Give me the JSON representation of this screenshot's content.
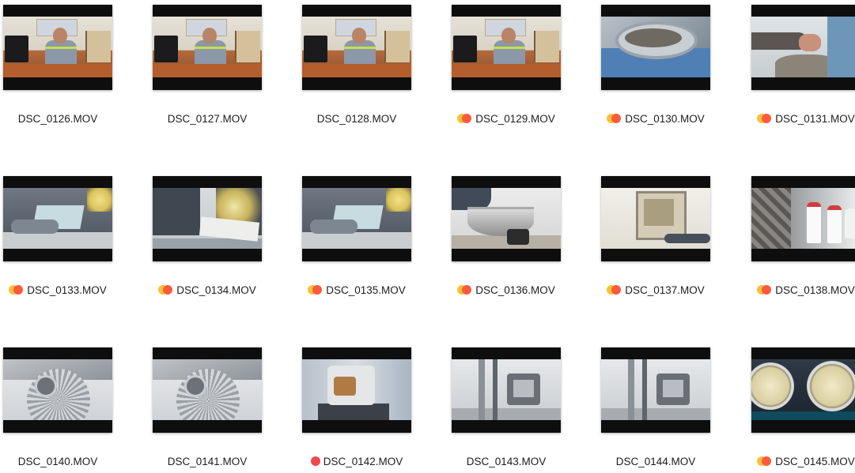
{
  "window": {
    "view": "Icon View"
  },
  "colors": {
    "tag_orange": "#f7c13a",
    "tag_red_orange": "#fb5a3c",
    "tag_red": "#f3474a",
    "thumbnail_letterbox": "#0e0e0e",
    "label_text": "#1d1d1d"
  },
  "files": [
    {
      "name": "DSC_0126.MOV",
      "tags": [],
      "scene": "office"
    },
    {
      "name": "DSC_0127.MOV",
      "tags": [],
      "scene": "office"
    },
    {
      "name": "DSC_0128.MOV",
      "tags": [],
      "scene": "office"
    },
    {
      "name": "DSC_0129.MOV",
      "tags": [
        "orange",
        "red-orange"
      ],
      "scene": "office"
    },
    {
      "name": "DSC_0130.MOV",
      "tags": [
        "orange",
        "red-orange"
      ],
      "scene": "pot"
    },
    {
      "name": "DSC_0131.MOV",
      "tags": [
        "orange",
        "red-orange"
      ],
      "scene": "hand"
    },
    {
      "name": "DSC_0133.MOV",
      "tags": [
        "orange",
        "red-orange"
      ],
      "scene": "lab"
    },
    {
      "name": "DSC_0134.MOV",
      "tags": [
        "orange",
        "red-orange"
      ],
      "scene": "machine2"
    },
    {
      "name": "DSC_0135.MOV",
      "tags": [
        "orange",
        "red-orange"
      ],
      "scene": "lab"
    },
    {
      "name": "DSC_0136.MOV",
      "tags": [
        "orange",
        "red-orange"
      ],
      "scene": "bowl"
    },
    {
      "name": "DSC_0137.MOV",
      "tags": [
        "orange",
        "red-orange"
      ],
      "scene": "oven"
    },
    {
      "name": "DSC_0138.MOV",
      "tags": [
        "orange",
        "red-orange"
      ],
      "scene": "bottles"
    },
    {
      "name": "DSC_0140.MOV",
      "tags": [],
      "scene": "saw"
    },
    {
      "name": "DSC_0141.MOV",
      "tags": [],
      "scene": "saw"
    },
    {
      "name": "DSC_0142.MOV",
      "tags": [
        "red"
      ],
      "scene": "motor"
    },
    {
      "name": "DSC_0143.MOV",
      "tags": [],
      "scene": "rig"
    },
    {
      "name": "DSC_0144.MOV",
      "tags": [],
      "scene": "rig"
    },
    {
      "name": "DSC_0145.MOV",
      "tags": [
        "orange",
        "red-orange"
      ],
      "scene": "gauges"
    }
  ]
}
